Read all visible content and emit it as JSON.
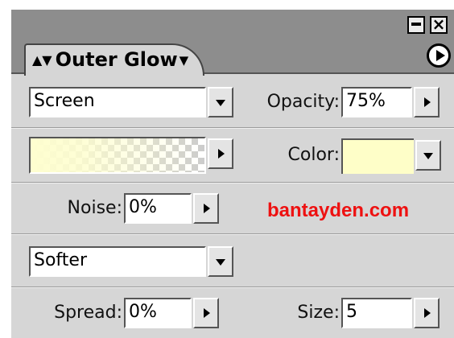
{
  "panel": {
    "tab_title": "Outer Glow",
    "close_glyph": "×"
  },
  "blend_mode": {
    "value": "Screen"
  },
  "opacity": {
    "label": "Opacity:",
    "value": "75%"
  },
  "color": {
    "label": "Color:",
    "swatch": "#fefec8"
  },
  "gradient": {
    "start_color": "#fefecf"
  },
  "noise": {
    "label": "Noise:",
    "value": "0%"
  },
  "watermark": {
    "text": "bantayden.com",
    "color": "#ee1111"
  },
  "technique": {
    "value": "Softer"
  },
  "spread": {
    "label": "Spread:",
    "value": "0%"
  },
  "size": {
    "label": "Size:",
    "value": "5"
  }
}
